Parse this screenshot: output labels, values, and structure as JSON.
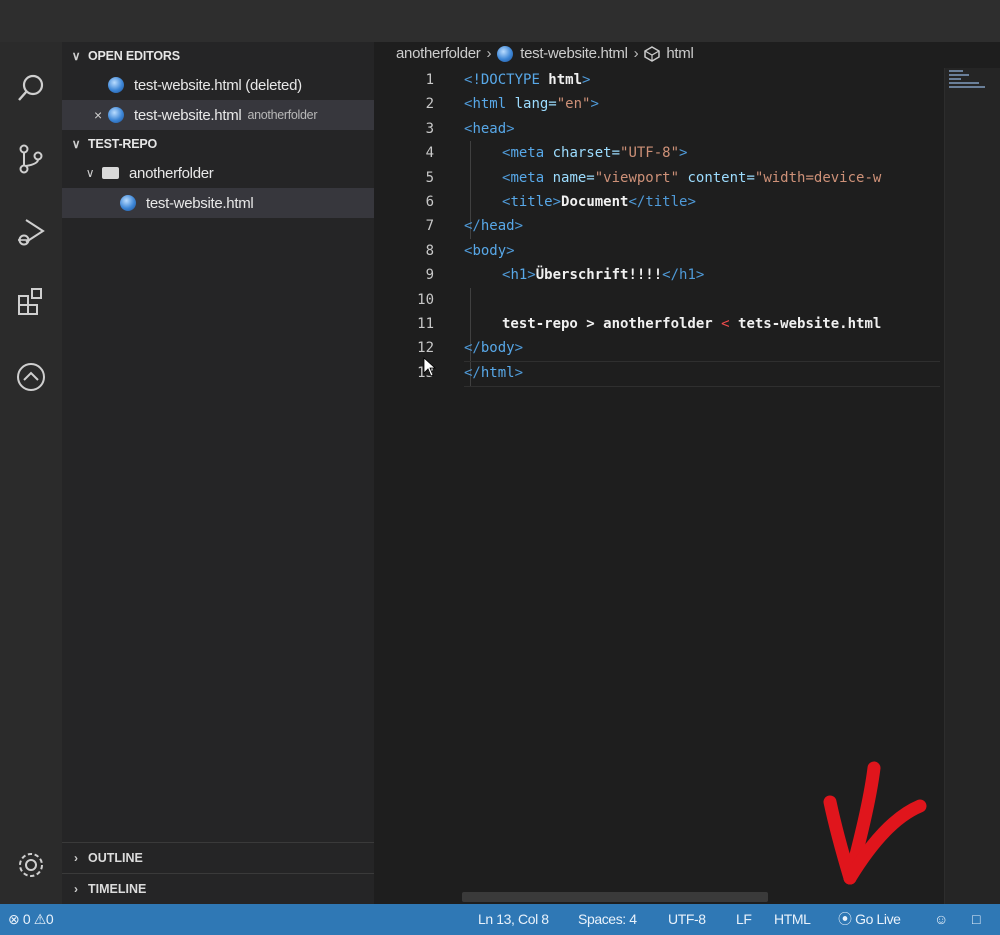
{
  "sidebar": {
    "open_editors": {
      "title": "OPEN EDITORS",
      "items": [
        {
          "label": "test-website.html (deleted)",
          "description": ""
        },
        {
          "label": "test-website.html",
          "description": "anotherfolder"
        }
      ]
    },
    "explorer": {
      "title": "TEST-REPO",
      "folder": "anotherfolder",
      "file": "test-website.html"
    },
    "outline_title": "OUTLINE",
    "timeline_title": "TIMELINE"
  },
  "activity_bar": [
    "search-icon",
    "source-control-icon",
    "run-debug-icon",
    "extensions-icon",
    "remote-icon",
    "settings-gear-icon"
  ],
  "breadcrumb": {
    "folder": "anotherfolder",
    "file": "test-website.html",
    "symbol": "html"
  },
  "editor": {
    "line_numbers": [
      "1",
      "2",
      "3",
      "4",
      "5",
      "6",
      "7",
      "8",
      "9",
      "10",
      "11",
      "12",
      "13"
    ],
    "lines": [
      {
        "lt": "<",
        "tag": "!DOCTYPE",
        "attr": " html",
        "gt": ">"
      },
      {
        "lt": "<",
        "tag": "html",
        "attr": " lang=",
        "val": "\"en\"",
        "gt": ">"
      },
      {
        "lt": "<",
        "tag": "head",
        "gt": ">"
      },
      {
        "lt": "<",
        "tag": "meta",
        "attr": " charset=",
        "val": "\"UTF-8\"",
        "gt": ">"
      },
      {
        "lt": "<",
        "tag": "meta",
        "attr": " name=",
        "val": "\"viewport\"",
        "attr2": " content=",
        "val2": "\"width=device-w"
      },
      {
        "lt": "<",
        "tag": "title",
        "gt": ">",
        "text": "Document",
        "close": "</title>"
      },
      {
        "lt": "</",
        "tag": "head",
        "gt": ">"
      },
      {
        "lt": "<",
        "tag": "body",
        "gt": ">"
      },
      {
        "lt": "<",
        "tag": "h1",
        "gt": ">",
        "text": "Überschrift!!!!",
        "close": "</h1>"
      },
      {
        "text": ""
      },
      {
        "text": "test-repo > anotherfolder ",
        "red": "<",
        "text2": " tets-website.html"
      },
      {
        "lt": "</",
        "tag": "body",
        "gt": ">"
      },
      {
        "lt": "</",
        "tag": "html",
        "gt": ">"
      }
    ]
  },
  "status_bar": {
    "errors": "0",
    "warnings": "0",
    "position": "Ln 13, Col 8",
    "spaces": "Spaces: 4",
    "encoding": "UTF-8",
    "eol": "LF",
    "language": "HTML",
    "go_live": "Go Live"
  },
  "colors": {
    "status_bar": "#2f78b5",
    "annotation_arrow": "#e0151c",
    "tag": "#4f9ad8",
    "string": "#ce9178",
    "attribute": "#9cdcfe"
  }
}
